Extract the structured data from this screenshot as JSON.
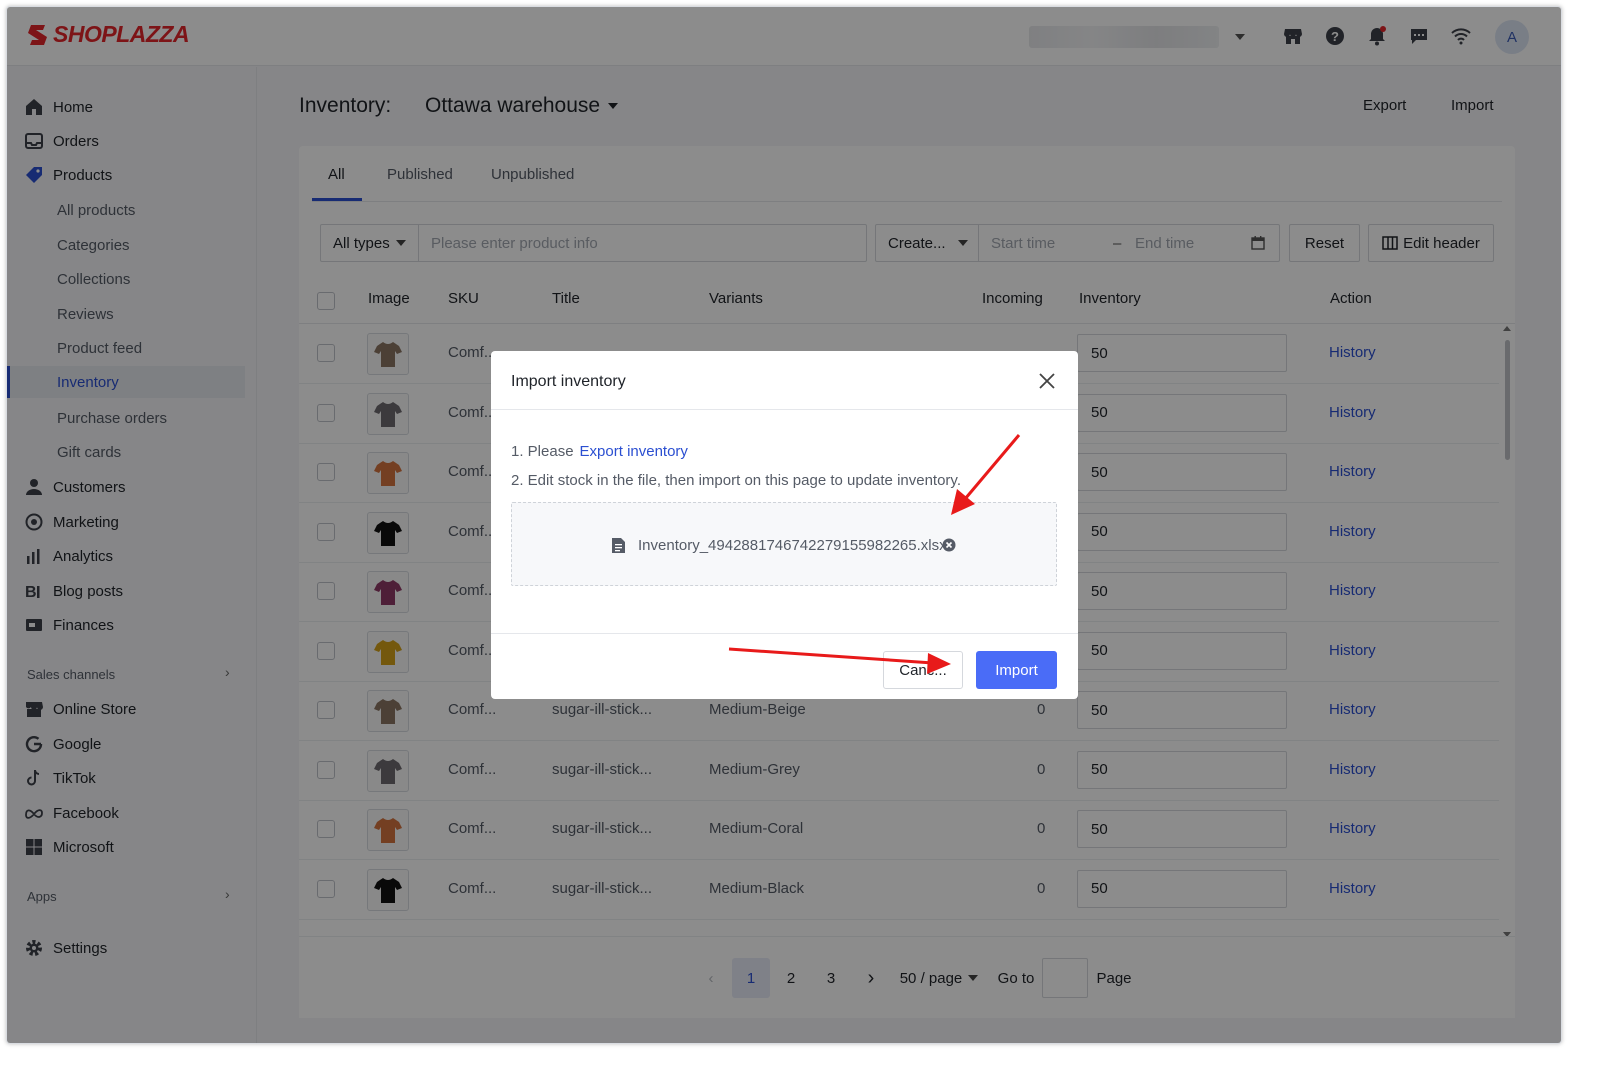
{
  "brand": {
    "name": "SHOPLAZZA",
    "color": "#e3262a",
    "accent": "#2b4fd1"
  },
  "topbar": {
    "icons": [
      "store-icon",
      "help-icon",
      "bell-icon",
      "chat-icon",
      "wifi-icon"
    ],
    "avatar_initial": "A"
  },
  "sidebar": {
    "main_items": [
      {
        "label": "Home",
        "icon": "home-icon"
      },
      {
        "label": "Orders",
        "icon": "inbox-icon"
      },
      {
        "label": "Products",
        "icon": "tag-icon"
      }
    ],
    "product_sub_items": [
      {
        "label": "All products"
      },
      {
        "label": "Categories"
      },
      {
        "label": "Collections"
      },
      {
        "label": "Reviews"
      },
      {
        "label": "Product feed"
      },
      {
        "label": "Inventory",
        "active": true
      },
      {
        "label": "Purchase orders"
      },
      {
        "label": "Gift cards"
      }
    ],
    "more_items": [
      {
        "label": "Customers",
        "icon": "person-icon"
      },
      {
        "label": "Marketing",
        "icon": "target-icon"
      },
      {
        "label": "Analytics",
        "icon": "bar-chart-icon"
      },
      {
        "label": "Blog posts",
        "icon": "blog-icon"
      },
      {
        "label": "Finances",
        "icon": "finance-icon"
      }
    ],
    "sales_channels_label": "Sales channels",
    "channels": [
      {
        "label": "Online Store",
        "icon": "store-icon"
      },
      {
        "label": "Google",
        "icon": "google-icon"
      },
      {
        "label": "TikTok",
        "icon": "tiktok-icon"
      },
      {
        "label": "Facebook",
        "icon": "meta-icon"
      },
      {
        "label": "Microsoft",
        "icon": "microsoft-icon"
      }
    ],
    "apps_label": "Apps",
    "settings_label": "Settings"
  },
  "header": {
    "title": "Inventory:",
    "warehouse": "Ottawa warehouse",
    "export_label": "Export",
    "import_label": "Import"
  },
  "tabs": [
    {
      "label": "All",
      "active": true
    },
    {
      "label": "Published"
    },
    {
      "label": "Unpublished"
    }
  ],
  "filters": {
    "type_select": "All types",
    "search_placeholder": "Please enter product info",
    "date_type_select": "Create...",
    "start_placeholder": "Start time",
    "range_separator": "–",
    "end_placeholder": "End time",
    "reset_label": "Reset",
    "edit_header_label": "Edit header"
  },
  "table": {
    "columns": [
      "Image",
      "SKU",
      "Title",
      "Variants",
      "Incoming",
      "Inventory",
      "Action"
    ],
    "rows": [
      {
        "color": "#8a7663",
        "sku": "Comf...",
        "title": "",
        "variant": "",
        "incoming": "",
        "inventory": "50",
        "action": "History"
      },
      {
        "color": "#6e6a70",
        "sku": "Comf...",
        "title": "",
        "variant": "",
        "incoming": "",
        "inventory": "50",
        "action": "History"
      },
      {
        "color": "#d4743f",
        "sku": "Comf...",
        "title": "",
        "variant": "",
        "incoming": "",
        "inventory": "50",
        "action": "History"
      },
      {
        "color": "#111111",
        "sku": "Comf...",
        "title": "",
        "variant": "",
        "incoming": "",
        "inventory": "50",
        "action": "History"
      },
      {
        "color": "#8f3a66",
        "sku": "Comf...",
        "title": "",
        "variant": "",
        "incoming": "",
        "inventory": "50",
        "action": "History"
      },
      {
        "color": "#d4a018",
        "sku": "Comf...",
        "title": "",
        "variant": "",
        "incoming": "",
        "inventory": "50",
        "action": "History"
      },
      {
        "color": "#8a7663",
        "sku": "Comf...",
        "title": "sugar-ill-stick...",
        "variant": "Medium-Beige",
        "incoming": "0",
        "inventory": "50",
        "action": "History"
      },
      {
        "color": "#6e6a70",
        "sku": "Comf...",
        "title": "sugar-ill-stick...",
        "variant": "Medium-Grey",
        "incoming": "0",
        "inventory": "50",
        "action": "History"
      },
      {
        "color": "#d4743f",
        "sku": "Comf...",
        "title": "sugar-ill-stick...",
        "variant": "Medium-Coral",
        "incoming": "0",
        "inventory": "50",
        "action": "History"
      },
      {
        "color": "#111111",
        "sku": "Comf...",
        "title": "sugar-ill-stick...",
        "variant": "Medium-Black",
        "incoming": "0",
        "inventory": "50",
        "action": "History"
      }
    ]
  },
  "pagination": {
    "pages": [
      "1",
      "2",
      "3"
    ],
    "current": "1",
    "page_size": "50 / page",
    "goto_label": "Go to",
    "page_label": "Page"
  },
  "modal": {
    "title": "Import inventory",
    "step1_prefix": "1. Please",
    "step1_link": "Export inventory",
    "step2": "2. Edit stock in the file, then import on this page to update inventory.",
    "file_name": "Inventory_4942881746742279155982265.xlsx",
    "cancel_label": "Canc...",
    "import_label": "Import",
    "import_color": "#4a6cf7",
    "annotation_color": "#e81a1a"
  }
}
